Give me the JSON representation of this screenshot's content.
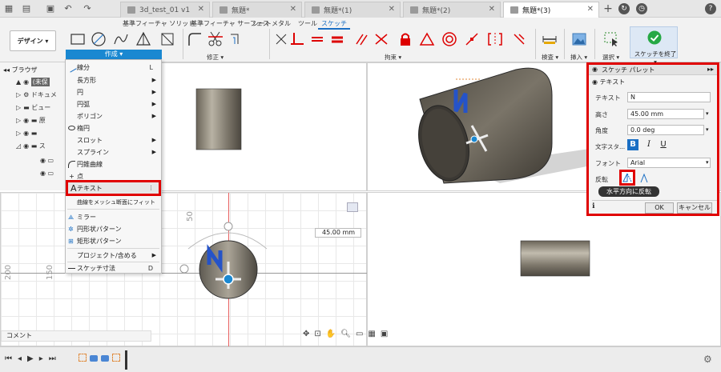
{
  "titlebar": {
    "tabs": [
      {
        "label": "3d_test_01 v1",
        "active": false
      },
      {
        "label": "無題*",
        "active": false
      },
      {
        "label": "無題*(1)",
        "active": false
      },
      {
        "label": "無題*(2)",
        "active": false
      },
      {
        "label": "無題*(3)",
        "active": true
      }
    ]
  },
  "ribbon": {
    "tabs": [
      "基準フィーチャ ソリッド",
      "基準フィーチャ サーフェス",
      "シートメタル",
      "ツール",
      "スケッチ"
    ],
    "active_tab": "スケッチ",
    "design_label": "デザイン",
    "groups": {
      "create": "作成",
      "modify": "修正",
      "constraints": "拘束",
      "inspect": "検査",
      "insert": "挿入",
      "select": "選択",
      "finish": "スケッチを終了"
    }
  },
  "browser": {
    "title": "ブラウザ",
    "items": [
      "(未保",
      "ドキュメ",
      "ビュー",
      "原",
      "ス"
    ],
    "comment": "コメント"
  },
  "menu": {
    "items": [
      {
        "label": "線分",
        "key": "L",
        "sub": false
      },
      {
        "label": "長方形",
        "key": "",
        "sub": true
      },
      {
        "label": "円",
        "key": "",
        "sub": true
      },
      {
        "label": "円弧",
        "key": "",
        "sub": true
      },
      {
        "label": "ポリゴン",
        "key": "",
        "sub": true
      },
      {
        "label": "楕円",
        "key": "",
        "sub": false
      },
      {
        "label": "スロット",
        "key": "",
        "sub": true
      },
      {
        "label": "スプライン",
        "key": "",
        "sub": true
      },
      {
        "label": "円錐曲線",
        "key": "",
        "sub": false
      },
      {
        "label": "点",
        "key": "",
        "sub": false
      },
      {
        "label": "テキスト",
        "key": "",
        "sub": false
      },
      {
        "label": "曲線をメッシュ断面にフィット",
        "key": "",
        "sub": false
      },
      {
        "label": "ミラー",
        "key": "",
        "sub": false
      },
      {
        "label": "円形状パターン",
        "key": "",
        "sub": false
      },
      {
        "label": "矩形状パターン",
        "key": "",
        "sub": false
      },
      {
        "label": "プロジェクト/含める",
        "key": "",
        "sub": true
      },
      {
        "label": "スケッチ寸法",
        "key": "D",
        "sub": false
      }
    ]
  },
  "palette": {
    "title": "スケッチ パレット",
    "section": "テキスト",
    "text_label": "テキスト",
    "text_value": "N",
    "height_label": "高さ",
    "height_value": "45.00 mm",
    "angle_label": "角度",
    "angle_value": "0.0 deg",
    "style_label": "文字スタ...",
    "font_label": "フォント",
    "font_value": "Arial",
    "flip_label": "反転",
    "tooltip": "水平方向に反転",
    "ok": "OK",
    "cancel": "キャンセル"
  },
  "viewport": {
    "dimension_input": "45.00 mm",
    "ruler_labels": [
      "50",
      "150",
      "200"
    ]
  }
}
